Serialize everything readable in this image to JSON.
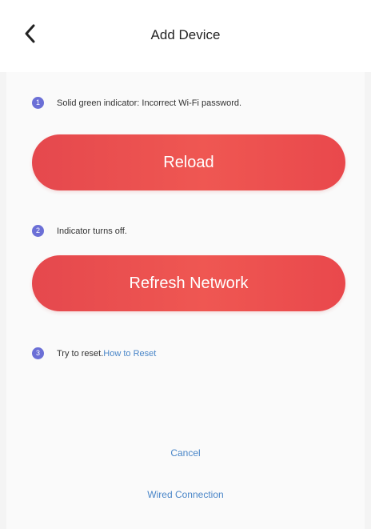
{
  "header": {
    "title": "Add Device",
    "back_icon": "chevron-left-icon"
  },
  "steps": [
    {
      "number": "1",
      "text": "Solid green indicator: Incorrect Wi-Fi password."
    },
    {
      "number": "2",
      "text": "Indicator turns off."
    },
    {
      "number": "3",
      "text": "Try to reset.",
      "link": "How to Reset"
    }
  ],
  "buttons": {
    "reload_label": "Reload",
    "refresh_label": "Refresh Network"
  },
  "footer": {
    "cancel_label": "Cancel",
    "wired_label": "Wired Connection"
  },
  "colors": {
    "accent_red": "#ec5050",
    "step_badge": "#6b6fd6",
    "link": "#4a86c8"
  }
}
